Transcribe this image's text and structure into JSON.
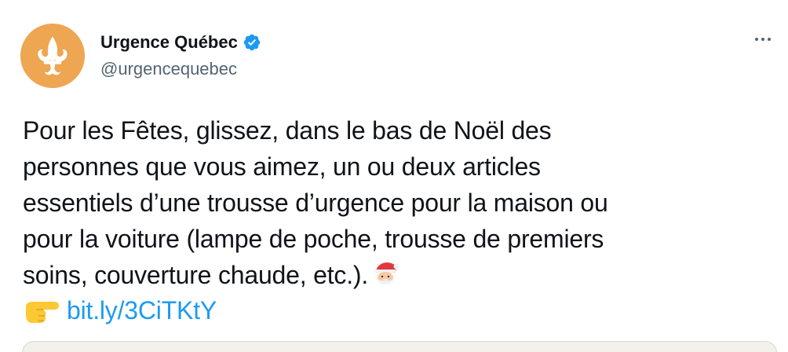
{
  "author": {
    "display_name": "Urgence Québec",
    "handle": "@urgencequebec",
    "avatar_icon": "fleur-de-lis-icon",
    "avatar_color": "#eea652",
    "verified": true,
    "verified_color": "#1d9bf0"
  },
  "menu": {
    "icon": "more-horizontal-icon"
  },
  "tweet": {
    "lines": [
      "Pour les Fêtes, glissez, dans le bas de Noël des",
      "personnes que vous aimez, un ou deux articles",
      "essentiels d’une trousse d’urgence pour la maison ou",
      "pour la voiture (lampe de poche, trousse de premiers",
      "soins, couverture chaude, etc.)."
    ],
    "end_emoji": "santa-icon",
    "link_emoji": "backhand-index-pointing-right-icon",
    "link_text": "bit.ly/3CiTKtY"
  },
  "colors": {
    "text": "#0f1419",
    "secondary": "#536471",
    "link": "#1d9bf0"
  }
}
